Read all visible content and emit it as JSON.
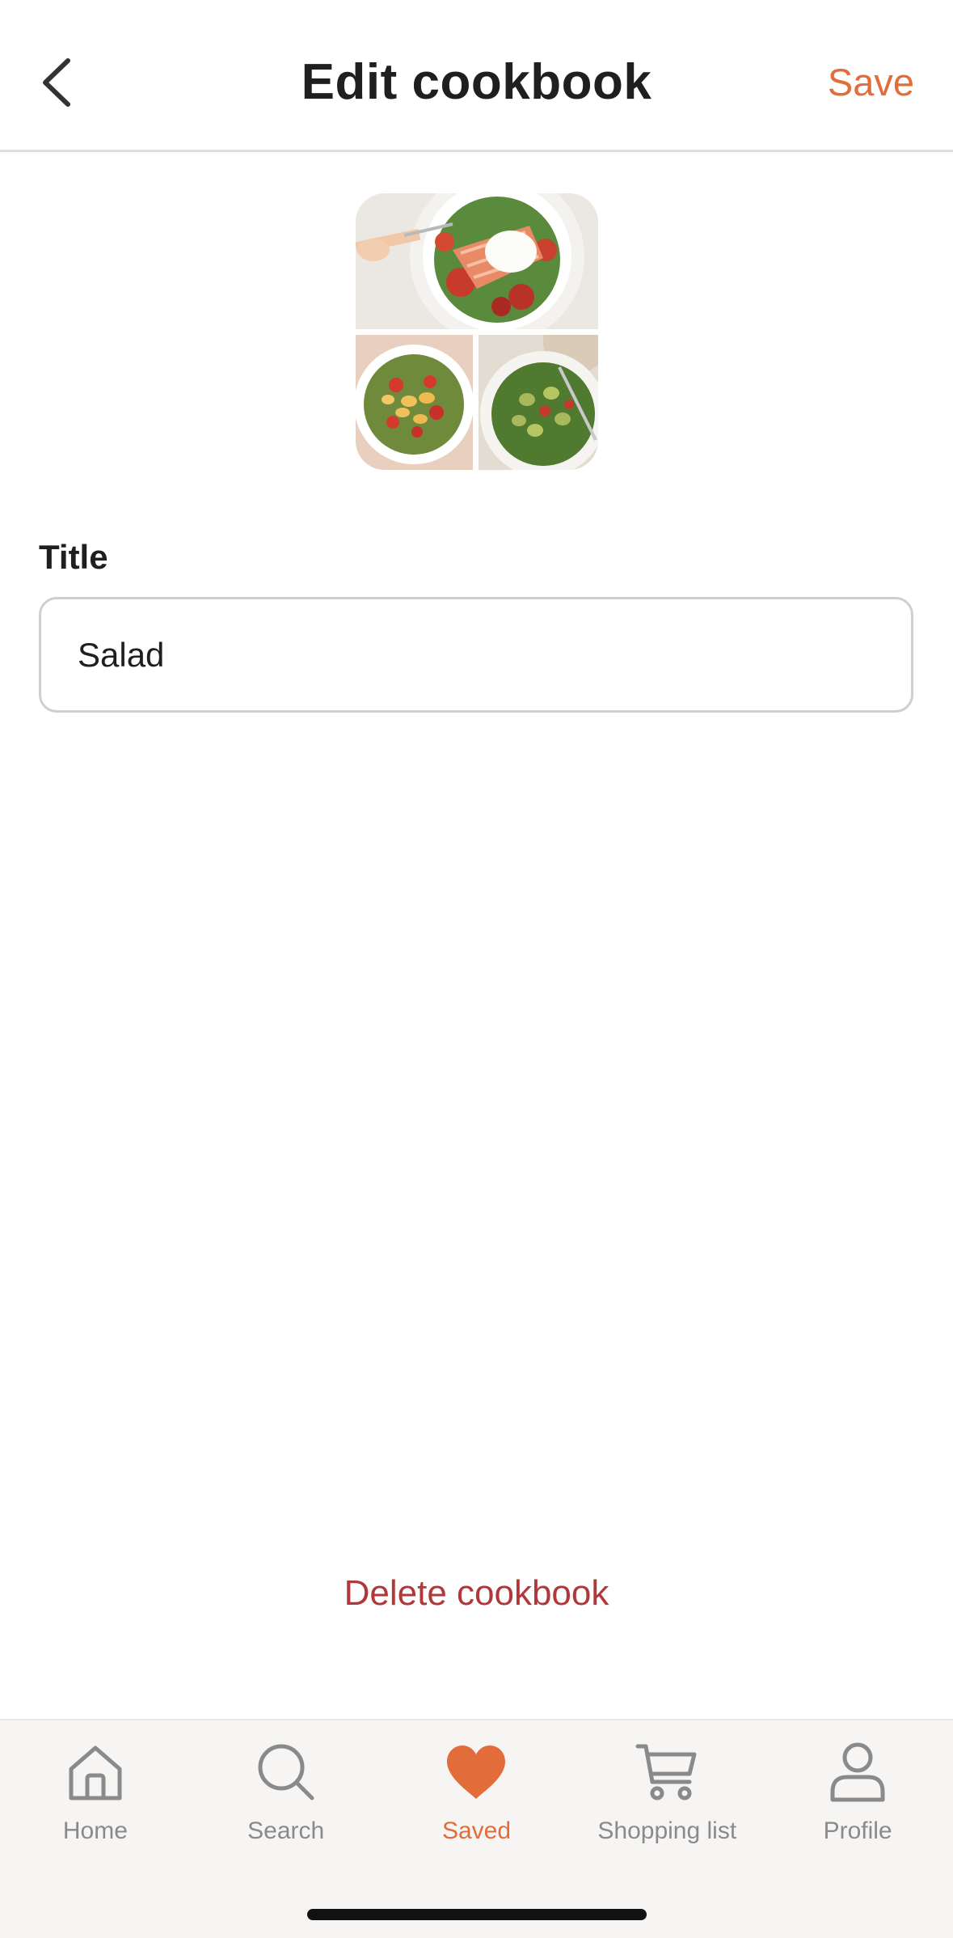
{
  "header": {
    "title": "Edit cookbook",
    "save_label": "Save",
    "back_icon": "chevron-left-icon"
  },
  "cover": {
    "images": [
      "salmon-salad-photo",
      "tortellini-salad-photo",
      "gnocchi-pesto-salad-photo"
    ]
  },
  "form": {
    "title_label": "Title",
    "title_value": "Salad"
  },
  "actions": {
    "delete_label": "Delete cookbook"
  },
  "tabbar": {
    "items": [
      {
        "label": "Home",
        "icon": "home-icon",
        "active": false
      },
      {
        "label": "Search",
        "icon": "search-icon",
        "active": false
      },
      {
        "label": "Saved",
        "icon": "heart-icon",
        "active": true
      },
      {
        "label": "Shopping list",
        "icon": "cart-icon",
        "active": false
      },
      {
        "label": "Profile",
        "icon": "person-icon",
        "active": false
      }
    ]
  },
  "colors": {
    "accent": "#e26d3a",
    "danger": "#b0383a",
    "inactive": "#8a8a8a"
  }
}
